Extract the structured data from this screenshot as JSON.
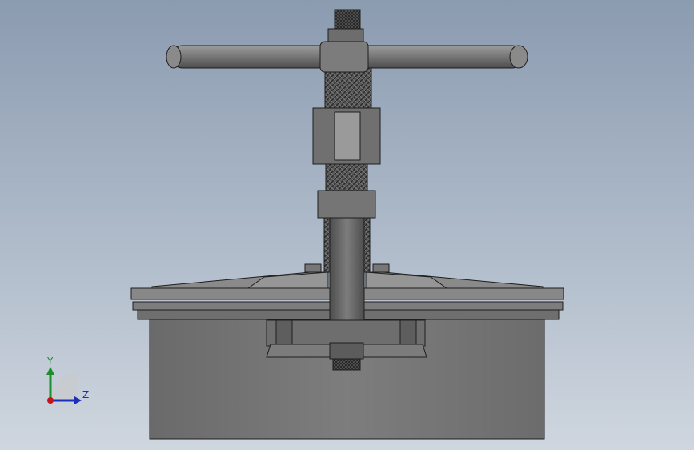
{
  "viewport": {
    "background_top": "#8b9bb0",
    "background_bottom": "#cfd6df"
  },
  "triad": {
    "y_label": "Y",
    "z_label": "Z",
    "y_color": "#1a8f2a",
    "z_color": "#1b2fb8",
    "x_color": "#c0161c"
  },
  "model": {
    "body_color": "#7a7a7a",
    "edge_color": "#1e1e1e",
    "icons": [
      "t-handle-icon",
      "threaded-screw-icon",
      "hex-nut-icon",
      "flange-plate-icon",
      "housing-block-icon"
    ]
  }
}
